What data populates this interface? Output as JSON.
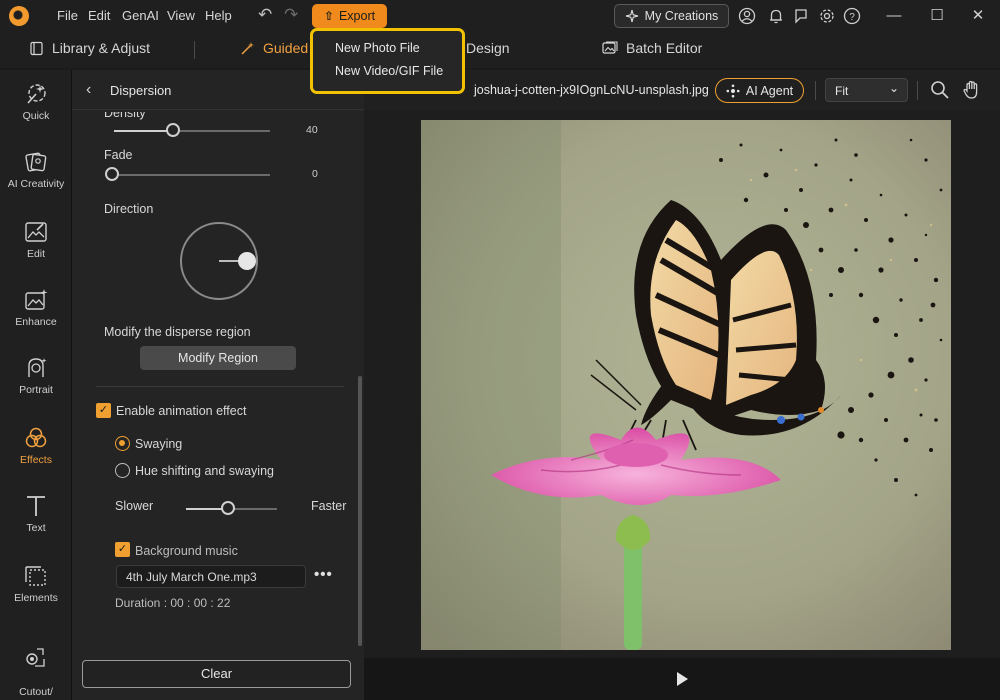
{
  "menu": {
    "file": "File",
    "edit": "Edit",
    "genai": "GenAI",
    "view": "View",
    "help": "Help"
  },
  "titlebar": {
    "export_label": "Export",
    "my_creations_label": "My Creations"
  },
  "modes": {
    "library": "Library & Adjust",
    "guided": "Guided",
    "design": "Design",
    "batch": "Batch Editor"
  },
  "export_menu": {
    "items": [
      "New Photo File",
      "New Video/GIF File"
    ]
  },
  "rail": {
    "items": [
      {
        "label": "Quick"
      },
      {
        "label": "AI Creativity"
      },
      {
        "label": "Edit"
      },
      {
        "label": "Enhance"
      },
      {
        "label": "Portrait"
      },
      {
        "label": "Effects"
      },
      {
        "label": "Text"
      },
      {
        "label": "Elements"
      },
      {
        "label": "Cutout/\nBackground"
      }
    ],
    "active": "Effects"
  },
  "panel": {
    "title": "Dispersion",
    "density": {
      "label": "Density",
      "value": "40"
    },
    "fade": {
      "label": "Fade",
      "value": "0"
    },
    "direction_label": "Direction",
    "modify_region_label": "Modify the disperse region",
    "modify_region_button": "Modify Region",
    "animation": {
      "checkbox_label": "Enable animation effect",
      "checked": true,
      "options": [
        "Swaying",
        "Hue shifting and swaying"
      ],
      "selected": "Swaying",
      "speed_slow": "Slower",
      "speed_fast": "Faster"
    },
    "music": {
      "checkbox_label": "Background music",
      "checked": true,
      "file": "4th July March One.mp3",
      "duration": "Duration : 00 : 00 : 22"
    },
    "clear_button": "Clear"
  },
  "canvas": {
    "filename": "joshua-j-cotten-jx9IOgnLcNU-unsplash.jpg",
    "ai_agent_label": "AI Agent",
    "zoom": "Fit"
  },
  "colors": {
    "accent": "#f0a030",
    "highlight_border": "#f2c200",
    "export_bg": "#f08a1c"
  }
}
